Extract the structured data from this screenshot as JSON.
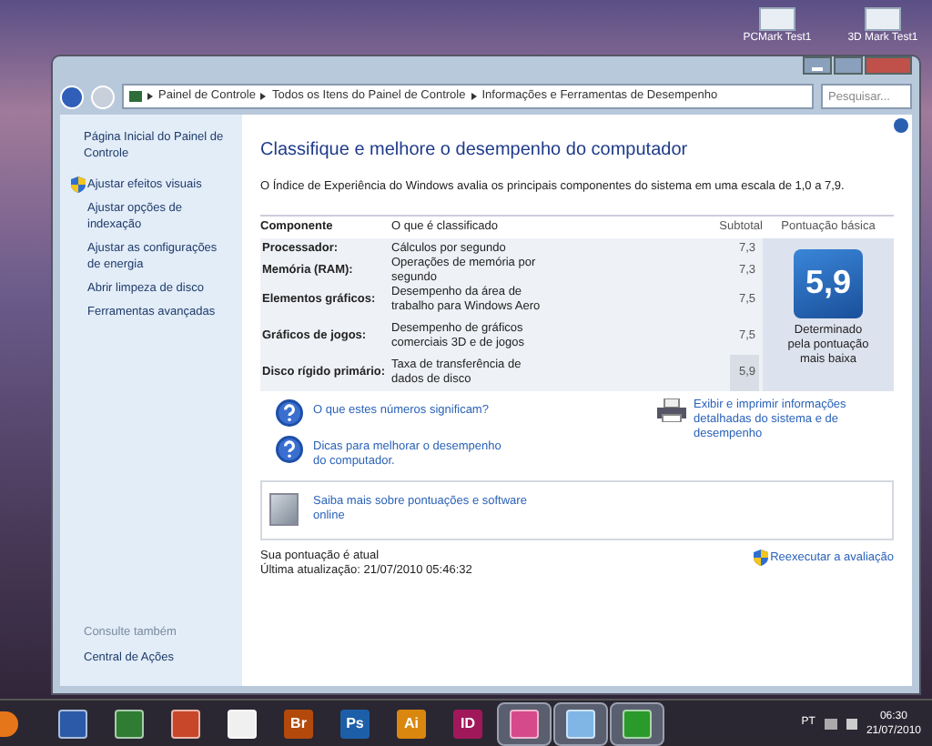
{
  "desktop_icons": [
    {
      "label": "PCMark Test1"
    },
    {
      "label": "3D Mark Test1"
    }
  ],
  "window": {
    "breadcrumb": [
      "Painel de Controle",
      "Todos os Itens do Painel de Controle",
      "Informações e Ferramentas de Desempenho"
    ],
    "search": {
      "placeholder": "Pesquisar..."
    }
  },
  "sidebar": {
    "home": "Página Inicial do Painel de Controle",
    "items": [
      {
        "label": "Ajustar efeitos visuais",
        "shield": true
      },
      {
        "label": "Ajustar opções de indexação",
        "shield": false
      },
      {
        "label": "Ajustar as configurações de energia",
        "shield": false
      },
      {
        "label": "Abrir limpeza de disco",
        "shield": false
      },
      {
        "label": "Ferramentas avançadas",
        "shield": false
      }
    ],
    "see_also": "Consulte também",
    "see_also_items": [
      "Central de Ações"
    ]
  },
  "content": {
    "title": "Classifique e melhore o desempenho do computador",
    "intro": "O Índice de Experiência do Windows avalia os principais componentes do sistema em uma escala de 1,0 a 7,9.",
    "table": {
      "columns": [
        "Componente",
        "O que é classificado",
        "Subtotal",
        "Pontuação básica"
      ],
      "rows": [
        {
          "component": "Processador:",
          "description": "Cálculos por segundo",
          "subtotal": "7,3",
          "lowest": false
        },
        {
          "component": "Memória (RAM):",
          "description": "Operações de memória por segundo",
          "subtotal": "7,3",
          "lowest": false
        },
        {
          "component": "Elementos gráficos:",
          "description": "Desempenho da área de trabalho para Windows Aero",
          "subtotal": "7,5",
          "lowest": false
        },
        {
          "component": "Gráficos de jogos:",
          "description": "Desempenho de gráficos comerciais 3D e de jogos",
          "subtotal": "7,5",
          "lowest": false
        },
        {
          "component": "Disco rígido primário:",
          "description": "Taxa de transferência de dados de disco",
          "subtotal": "5,9",
          "lowest": true
        }
      ],
      "base_score": "5,9",
      "base_note": "Determinado pela pontuação mais baixa"
    },
    "help_links": [
      "O que estes números significam?",
      "Dicas para melhorar o desempenho do computador."
    ],
    "print_link": "Exibir e imprimir informações detalhadas do sistema e de desempenho",
    "online_link": "Saiba mais sobre pontuações e software online",
    "status": "Sua pontuação é atual",
    "updated": "Última atualização: 21/07/2010 05:46:32",
    "rerun": "Reexecutar a avaliação"
  },
  "taskbar": {
    "apps": [
      {
        "kind": "word",
        "active": false
      },
      {
        "kind": "excel",
        "active": false
      },
      {
        "kind": "powerpoint",
        "active": false
      },
      {
        "kind": "acrobat",
        "active": false
      },
      {
        "kind": "logo",
        "label": "Br",
        "color": "#b34a0c",
        "active": false
      },
      {
        "kind": "logo",
        "label": "Ps",
        "color": "#1c5fa8",
        "active": false
      },
      {
        "kind": "logo",
        "label": "Ai",
        "color": "#d9870f",
        "active": false
      },
      {
        "kind": "logo",
        "label": "ID",
        "color": "#a0185a",
        "active": false
      },
      {
        "kind": "app",
        "active": true
      },
      {
        "kind": "controlpanel",
        "active": true
      },
      {
        "kind": "torrent",
        "active": true
      }
    ],
    "language": "PT",
    "time": "06:30",
    "date": "21/07/2010"
  }
}
